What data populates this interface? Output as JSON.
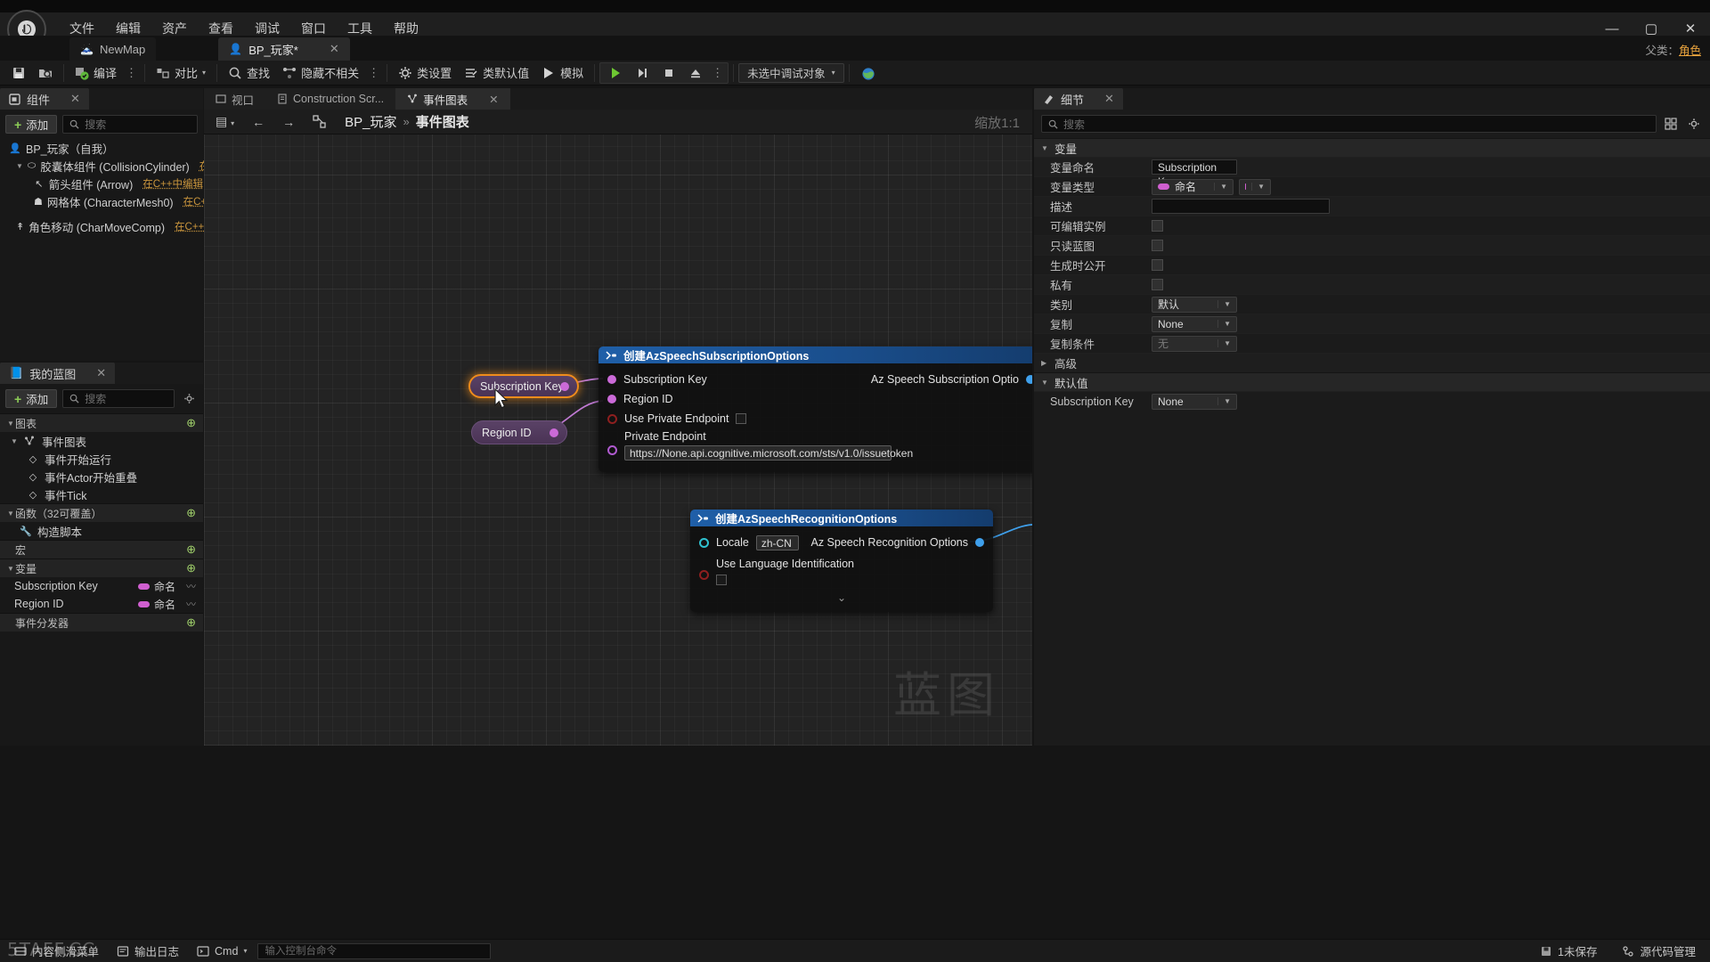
{
  "app": {
    "menu": [
      "文件",
      "编辑",
      "资产",
      "查看",
      "调试",
      "窗口",
      "工具",
      "帮助"
    ],
    "window_controls": {
      "minimize": "—",
      "maximize": "▢",
      "close": "✕"
    }
  },
  "tabs": {
    "map_tab": "NewMap",
    "asset_tab": "BP_玩家*",
    "asset_tab_close": "✕",
    "parent_label": "父类：",
    "parent_value": "角色"
  },
  "toolbar": {
    "save_label": "",
    "browse_label": "",
    "compile_label": "编译",
    "diff_label": "对比",
    "find_label": "查找",
    "hide_unrelated_label": "隐藏不相关",
    "class_settings_label": "类设置",
    "class_defaults_label": "类默认值",
    "simulate_label": "模拟",
    "debug_object": "未选中调试对象",
    "dots": "⋮"
  },
  "components_panel": {
    "title": "组件",
    "close": "✕",
    "add_label": "添加",
    "search_placeholder": "搜索",
    "tree": [
      {
        "label": "BP_玩家（自我）",
        "icon": "actor-icon",
        "depth": 0,
        "caret": "",
        "cpp": ""
      },
      {
        "label": "胶囊体组件 (CollisionCylinder)",
        "icon": "capsule-icon",
        "depth": 1,
        "caret": "▼",
        "cpp": "在C++"
      },
      {
        "label": "箭头组件 (Arrow)",
        "icon": "arrow-icon",
        "depth": 2,
        "caret": "",
        "cpp": "在C++中编辑"
      },
      {
        "label": "网格体 (CharacterMesh0)",
        "icon": "mesh-icon",
        "depth": 2,
        "caret": "",
        "cpp": "在C++中"
      },
      {
        "label": "角色移动 (CharMoveComp)",
        "icon": "move-icon",
        "depth": 1,
        "caret": "",
        "cpp": "在C++中"
      }
    ]
  },
  "my_blueprint_panel": {
    "title": "我的蓝图",
    "close": "✕",
    "add_label": "添加",
    "search_placeholder": "搜索",
    "settings_icon": "gear-icon",
    "sections": [
      {
        "label": "图表",
        "add": "⊕"
      },
      {
        "label": "函数（32可覆盖）",
        "add": "⊕"
      },
      {
        "label": "宏",
        "add": "⊕"
      },
      {
        "label": "变量",
        "add": "⊕"
      },
      {
        "label": "事件分发器",
        "add": "⊕"
      }
    ],
    "graph_root": "事件图表",
    "graph_events": [
      "事件开始运行",
      "事件Actor开始重叠",
      "事件Tick"
    ],
    "functions": [
      "构造脚本"
    ],
    "variables": [
      {
        "name": "Subscription Key",
        "type": "命名"
      },
      {
        "name": "Region ID",
        "type": "命名"
      }
    ]
  },
  "graph": {
    "tabs": [
      {
        "label": "视口",
        "icon": "viewport-icon",
        "active": false
      },
      {
        "label": "Construction Scr...",
        "icon": "script-icon",
        "active": false
      },
      {
        "label": "事件图表",
        "icon": "graph-icon",
        "active": true,
        "close": "✕"
      }
    ],
    "nav_back": "←",
    "nav_forward": "→",
    "home_icon": "home-icon",
    "breadcrumb_root": "BP_玩家",
    "breadcrumb_sep": "»",
    "breadcrumb_current": "事件图表",
    "zoom_label": "缩放1:1",
    "watermark": "蓝图",
    "nodes": {
      "get_subscription_key": {
        "label": "Subscription Key",
        "selected": true
      },
      "get_region_id": {
        "label": "Region ID",
        "selected": false
      },
      "subscription_options": {
        "title": "创建AzSpeechSubscriptionOptions",
        "inputs": [
          {
            "label": "Subscription Key",
            "pin": "name",
            "widget": "none"
          },
          {
            "label": "Region ID",
            "pin": "name",
            "widget": "none"
          },
          {
            "label": "Use Private Endpoint",
            "pin": "bool",
            "widget": "checkbox"
          },
          {
            "label": "Private Endpoint",
            "pin": "str",
            "widget": "text",
            "value": "https://None.api.cognitive.microsoft.com/sts/v1.0/issuetoken"
          }
        ],
        "output": {
          "label": "Az Speech Subscription Optio",
          "pin": "struct"
        }
      },
      "recognition_options": {
        "title": "创建AzSpeechRecognitionOptions",
        "inputs": [
          {
            "label": "Locale",
            "pin": "enum",
            "widget": "text",
            "value": "zh-CN"
          },
          {
            "label": "Use Language Identification",
            "pin": "bool",
            "widget": "checkbox"
          }
        ],
        "output": {
          "label": "Az Speech Recognition Options",
          "pin": "struct"
        },
        "expander": "⌄"
      }
    }
  },
  "details_panel": {
    "title": "细节",
    "close": "✕",
    "search_placeholder": "搜索",
    "grid_icon": "grid-icon",
    "settings_icon": "gear-icon",
    "sections": [
      {
        "label": "变量",
        "caret": "▼"
      },
      {
        "label": "默认值",
        "caret": "▼"
      }
    ],
    "variable_rows": [
      {
        "label": "变量命名",
        "kind": "input",
        "value": "Subscription Key"
      },
      {
        "label": "变量类型",
        "kind": "type",
        "value": "命名"
      },
      {
        "label": "描述",
        "kind": "input",
        "value": ""
      },
      {
        "label": "可编辑实例",
        "kind": "check",
        "value": ""
      },
      {
        "label": "只读蓝图",
        "kind": "check",
        "value": ""
      },
      {
        "label": "生成时公开",
        "kind": "check",
        "value": ""
      },
      {
        "label": "私有",
        "kind": "check",
        "value": ""
      },
      {
        "label": "类别",
        "kind": "combo",
        "value": "默认"
      },
      {
        "label": "复制",
        "kind": "combo",
        "value": "None"
      },
      {
        "label": "复制条件",
        "kind": "combo-dim",
        "value": "无"
      }
    ],
    "advanced_label": "高级",
    "advanced_caret": "▶",
    "default_rows": [
      {
        "label": "Subscription Key",
        "kind": "combo",
        "value": "None"
      }
    ]
  },
  "bottom_bar": {
    "content_drawer": "内容侧滑菜单",
    "output_log": "输出日志",
    "cmd_label": "Cmd",
    "cmd_placeholder": "输入控制台命令",
    "unsaved": "1未保存",
    "source_control": "源代码管理",
    "watermark": "5TAFF.CC"
  }
}
